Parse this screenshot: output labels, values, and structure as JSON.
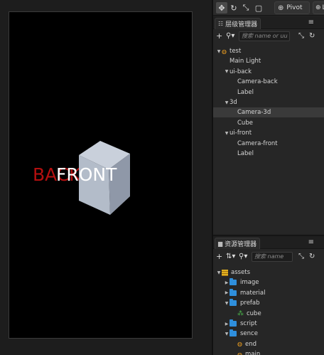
{
  "scene": {
    "back_label": "BACK",
    "front_label": "FRONT",
    "colors": {
      "back": "#b30f0f",
      "front": "#ffffff",
      "viewport_bg": "#000000"
    }
  },
  "toolbar": {
    "icons": [
      "move-tool-icon",
      "rotate-tool-icon",
      "scale-tool-icon",
      "rect-tool-icon"
    ],
    "pivot_label": "Pivot",
    "local_label": "L"
  },
  "hierarchy": {
    "title": "层级管理器",
    "search_placeholder": "搜索 name or uu",
    "nodes": [
      {
        "label": "test",
        "depth": 0,
        "arrow": "open",
        "icon": "flame"
      },
      {
        "label": "Main Light",
        "depth": 1,
        "arrow": "none"
      },
      {
        "label": "ui-back",
        "depth": 1,
        "arrow": "open"
      },
      {
        "label": "Camera-back",
        "depth": 2,
        "arrow": "none"
      },
      {
        "label": "Label",
        "depth": 2,
        "arrow": "none"
      },
      {
        "label": "3d",
        "depth": 1,
        "arrow": "open"
      },
      {
        "label": "Camera-3d",
        "depth": 2,
        "arrow": "none",
        "selected": true
      },
      {
        "label": "Cube",
        "depth": 2,
        "arrow": "none"
      },
      {
        "label": "ui-front",
        "depth": 1,
        "arrow": "open"
      },
      {
        "label": "Camera-front",
        "depth": 2,
        "arrow": "none"
      },
      {
        "label": "Label",
        "depth": 2,
        "arrow": "none"
      }
    ]
  },
  "assets": {
    "title": "资源管理器",
    "search_placeholder": "搜索 name",
    "nodes": [
      {
        "label": "assets",
        "depth": 0,
        "arrow": "open",
        "icon": "assets"
      },
      {
        "label": "image",
        "depth": 1,
        "arrow": "closed",
        "icon": "folder"
      },
      {
        "label": "material",
        "depth": 1,
        "arrow": "closed",
        "icon": "folder"
      },
      {
        "label": "prefab",
        "depth": 1,
        "arrow": "open",
        "icon": "folder"
      },
      {
        "label": "cube",
        "depth": 2,
        "arrow": "none",
        "icon": "prefab"
      },
      {
        "label": "script",
        "depth": 1,
        "arrow": "closed",
        "icon": "folder"
      },
      {
        "label": "sence",
        "depth": 1,
        "arrow": "open",
        "icon": "folder"
      },
      {
        "label": "end",
        "depth": 2,
        "arrow": "none",
        "icon": "flame"
      },
      {
        "label": "main",
        "depth": 2,
        "arrow": "none",
        "icon": "flame"
      }
    ]
  }
}
